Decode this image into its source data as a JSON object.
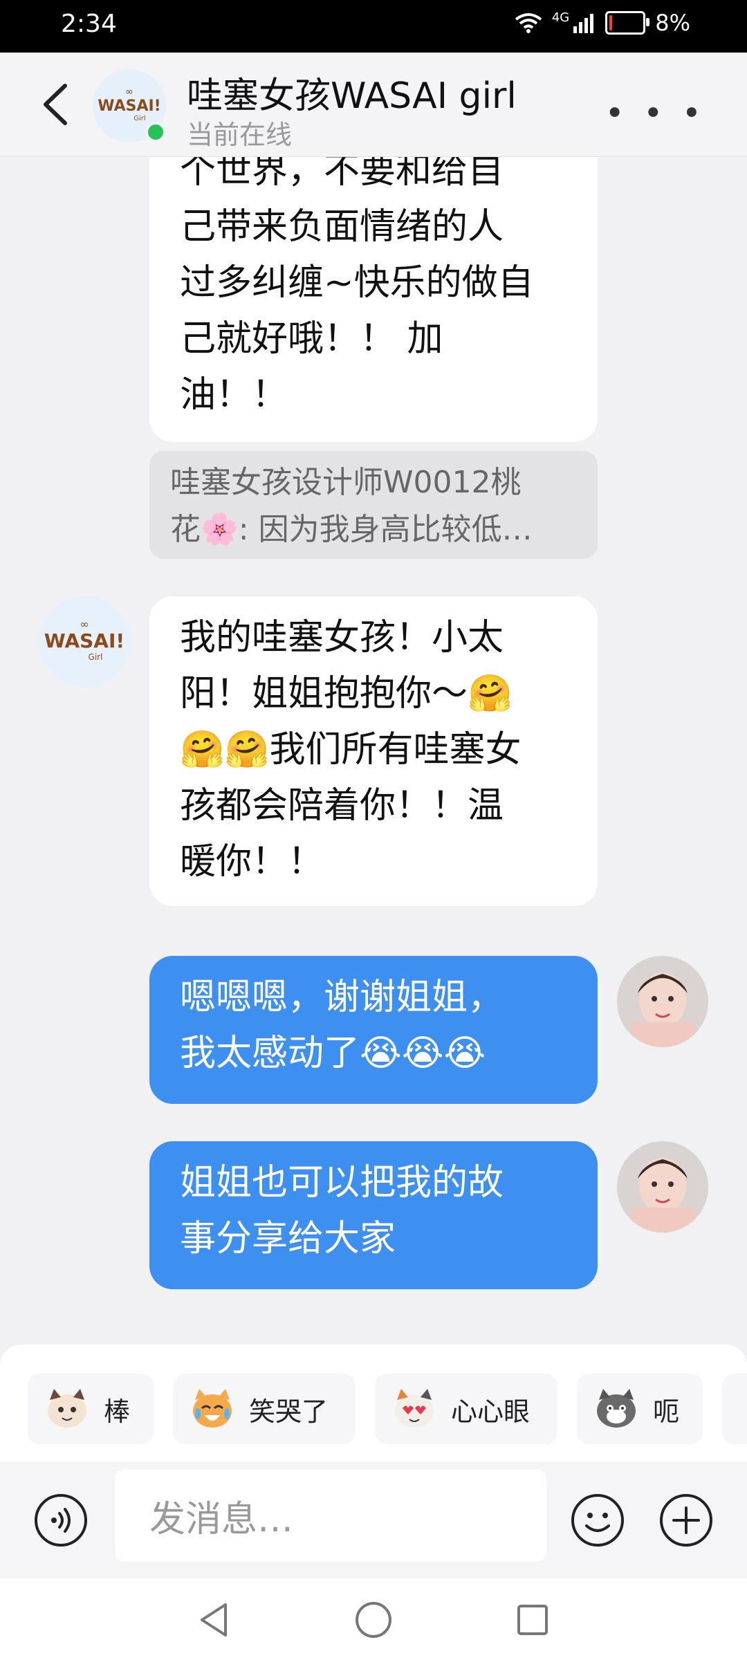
{
  "status": {
    "time": "2:34",
    "network": "4G",
    "battery": "8%",
    "battery_level": 0.08
  },
  "header": {
    "title": "哇塞女孩WASAI girl",
    "subtitle": "当前在线"
  },
  "avatar": {
    "logo_text": "WASAI!",
    "logo_small": "Girl"
  },
  "messages": [
    {
      "side": "left",
      "text": "个世界，不要和给自\n己带来负面情绪的人\n过多纠缠~快乐的做自\n己就好哦！！ 加\n油！！"
    },
    {
      "side": "quote",
      "text": "哇塞女孩设计师W0012桃\n花🌸: 因为我身高比较低…"
    },
    {
      "side": "left",
      "text": "我的哇塞女孩！小太\n阳！姐姐抱抱你～🤗\n🤗🤗我们所有哇塞女\n孩都会陪着你！！温\n暖你！！"
    },
    {
      "side": "right",
      "text": "嗯嗯嗯，谢谢姐姐，\n我太感动了😭😭😭"
    },
    {
      "side": "right",
      "text": "姐姐也可以把我的故\n事分享给大家"
    }
  ],
  "quick_replies": [
    {
      "label": "棒",
      "icon": "cat-thumbs-up-icon"
    },
    {
      "label": "笑哭了",
      "icon": "cat-laugh-cry-icon"
    },
    {
      "label": "心心眼",
      "icon": "cat-heart-eyes-icon"
    },
    {
      "label": "呃",
      "icon": "cat-awkward-icon"
    }
  ],
  "input": {
    "placeholder": "发消息…"
  },
  "colors": {
    "accent": "#3d8ff0",
    "online": "#25c25a",
    "background": "#f1f1f3"
  }
}
